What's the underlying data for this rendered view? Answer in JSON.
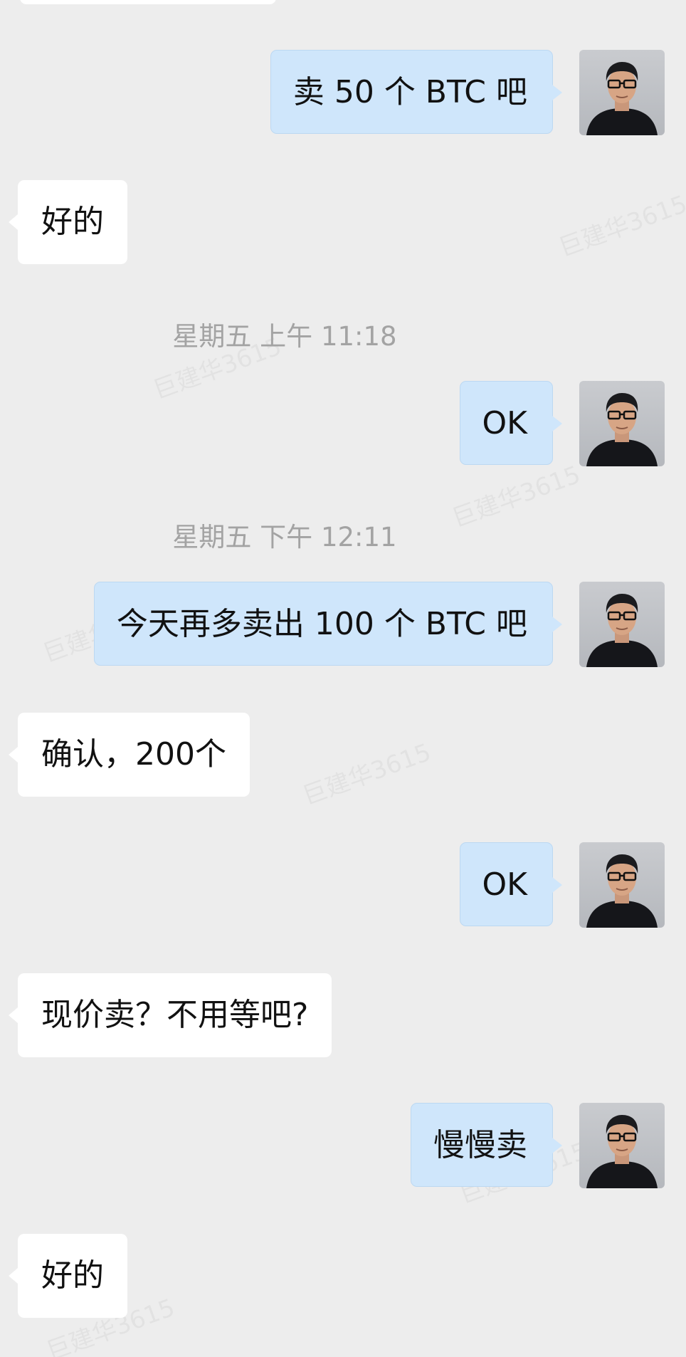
{
  "watermark": {
    "text": "巨建华3615"
  },
  "messages": [
    {
      "id": "m1",
      "side": "right",
      "type": "text",
      "text": "卖 50 个 BTC 吧"
    },
    {
      "id": "m2",
      "side": "left",
      "type": "text",
      "text": "好的"
    },
    {
      "id": "t1",
      "type": "timestamp",
      "text": "星期五 上午 11:18"
    },
    {
      "id": "m3",
      "side": "right",
      "type": "text",
      "text": "OK"
    },
    {
      "id": "t2",
      "type": "timestamp",
      "text": "星期五 下午 12:11"
    },
    {
      "id": "m4",
      "side": "right",
      "type": "text",
      "text": "今天再多卖出 100 个 BTC 吧"
    },
    {
      "id": "m5",
      "side": "left",
      "type": "text",
      "text": "确认，200个"
    },
    {
      "id": "m6",
      "side": "right",
      "type": "text",
      "text": "OK"
    },
    {
      "id": "m7",
      "side": "left",
      "type": "text",
      "text": "现价卖？不用等吧?"
    },
    {
      "id": "m8",
      "side": "right",
      "type": "text",
      "text": "慢慢卖"
    },
    {
      "id": "m9",
      "side": "left",
      "type": "text",
      "text": "好的"
    }
  ],
  "colors": {
    "background": "#ededed",
    "outgoing_bubble": "#cfe6fb",
    "incoming_bubble": "#ffffff",
    "timestamp": "#a3a3a3"
  },
  "icons": {
    "avatar": "user-avatar-photo"
  }
}
